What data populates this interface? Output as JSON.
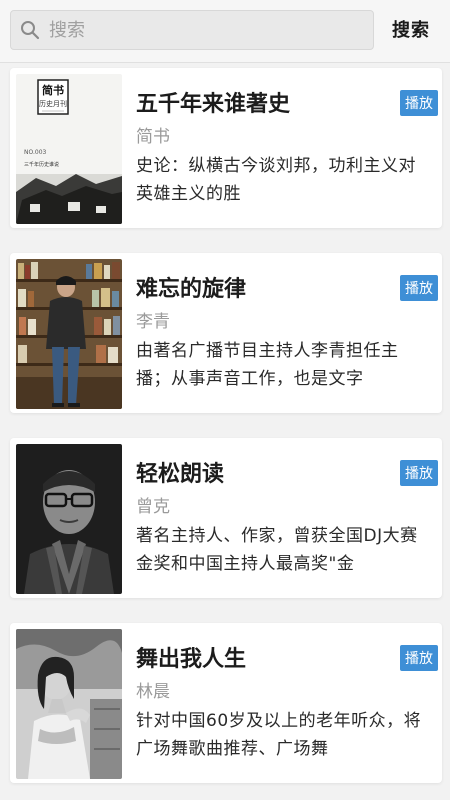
{
  "search": {
    "placeholder": "搜索",
    "button_label": "搜索"
  },
  "items": [
    {
      "title": "五千年来谁著史",
      "author": "简书",
      "desc": "史论：纵横古今谈刘邦，功利主义对英雄主义的胜",
      "play_label": "播放",
      "cover": {
        "line1": "简书",
        "line2": "历史月刊",
        "issue": "NO.003",
        "caption": "三千年历史谁说"
      }
    },
    {
      "title": "难忘的旋律",
      "author": "李青",
      "desc": "由著名广播节目主持人李青担任主播；从事声音工作，也是文字",
      "play_label": "播放"
    },
    {
      "title": "轻松朗读",
      "author": "曾克",
      "desc": "著名主持人、作家，曾获全国DJ大赛金奖和中国主持人最高奖\"金",
      "play_label": "播放"
    },
    {
      "title": "舞出我人生",
      "author": "林晨",
      "desc": "针对中国60岁及以上的老年听众，将广场舞歌曲推荐、广场舞",
      "play_label": "播放"
    }
  ],
  "colors": {
    "accent": "#3e8fd6",
    "title": "#1c1c1c",
    "author": "#9a9a9a"
  }
}
